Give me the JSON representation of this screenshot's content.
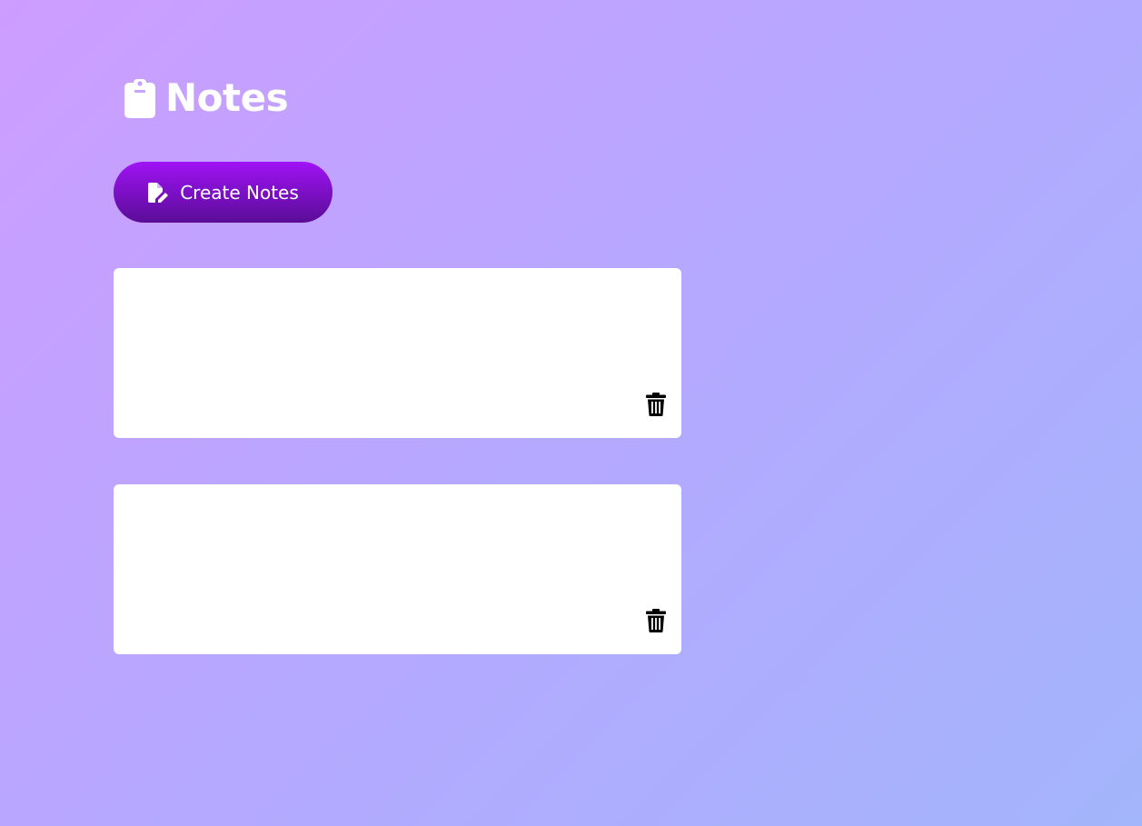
{
  "header": {
    "title": "Notes",
    "icon": "clipboard-icon"
  },
  "toolbar": {
    "create_label": "Create Notes",
    "create_icon": "file-edit-icon"
  },
  "notes": [
    {
      "text": "",
      "delete_icon": "trash-icon"
    },
    {
      "text": "",
      "delete_icon": "trash-icon"
    }
  ],
  "colors": {
    "background_start": "#cd9dff",
    "background_end": "#a3b5fb",
    "button_top": "#a013f5",
    "button_bottom": "#5a0c97",
    "note_background": "#ffffff"
  }
}
